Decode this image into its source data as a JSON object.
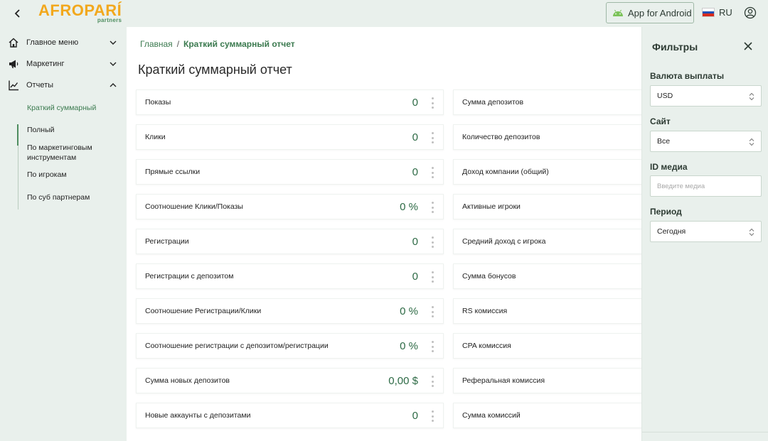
{
  "header": {
    "logo_main_a": "AFRO",
    "logo_main_b": "PARÍ",
    "logo_sub": "partners",
    "android_button": "App for Android",
    "language": "RU"
  },
  "sidebar": {
    "items": [
      {
        "label": "Главное меню",
        "icon": "home-icon"
      },
      {
        "label": "Маркетинг",
        "icon": "megaphone-icon"
      },
      {
        "label": "Отчеты",
        "icon": "chart-icon"
      }
    ],
    "subitems": [
      {
        "label": "Краткий суммарный"
      },
      {
        "label": "Полный"
      },
      {
        "label": "По маркетинговым инструментам"
      },
      {
        "label": "По игрокам"
      },
      {
        "label": "По суб партнерам"
      }
    ]
  },
  "main": {
    "breadcrumb_home": "Главная",
    "breadcrumb_sep": "/",
    "breadcrumb_current": "Краткий суммарный отчет",
    "title": "Краткий суммарный отчет",
    "left_cards": [
      {
        "label": "Показы",
        "value": "0"
      },
      {
        "label": "Клики",
        "value": "0"
      },
      {
        "label": "Прямые ссылки",
        "value": "0"
      },
      {
        "label": "Соотношение Клики/Показы",
        "value": "0 %"
      },
      {
        "label": "Регистрации",
        "value": "0"
      },
      {
        "label": "Регистрации с депозитом",
        "value": "0"
      },
      {
        "label": "Соотношение Регистрации/Клики",
        "value": "0 %"
      },
      {
        "label": "Соотношение регистрации с депозитом/регистрации",
        "value": "0 %"
      },
      {
        "label": "Сумма новых депозитов",
        "value": "0,00 $"
      },
      {
        "label": "Новые аккаунты с депозитами",
        "value": "0"
      }
    ],
    "right_cards": [
      {
        "label": "Сумма депозитов"
      },
      {
        "label": "Количество депозитов"
      },
      {
        "label": "Доход компании (общий)"
      },
      {
        "label": "Активные игроки"
      },
      {
        "label": "Средний доход с игрока"
      },
      {
        "label": "Сумма бонусов"
      },
      {
        "label": "RS комиссия"
      },
      {
        "label": "CPA комиссия"
      },
      {
        "label": "Реферальная комиссия"
      },
      {
        "label": "Сумма комиссий"
      }
    ]
  },
  "filters": {
    "title": "Фильтры",
    "currency_label": "Валюта выплаты",
    "currency_value": "USD",
    "site_label": "Сайт",
    "site_value": "Все",
    "media_label": "ID медиа",
    "media_placeholder": "Введите медиа",
    "period_label": "Период",
    "period_value": "Сегодня"
  },
  "colors": {
    "accent": "#3b7a4f",
    "logo": "#f2a81d",
    "background": "#e9f0ec"
  }
}
